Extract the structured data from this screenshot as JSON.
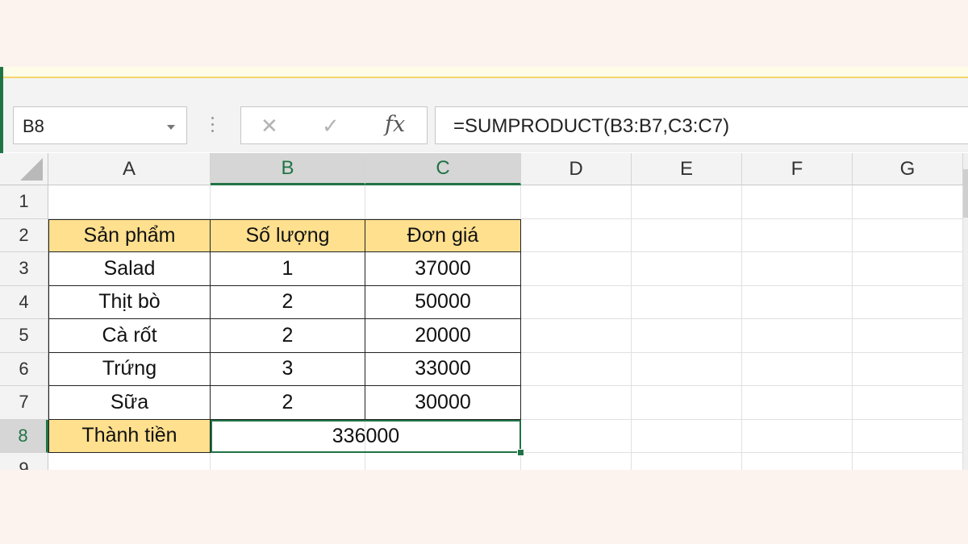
{
  "formula_bar": {
    "name_box": "B8",
    "cancel_icon": "✕",
    "enter_icon": "✓",
    "fx_label": "fx",
    "formula": "=SUMPRODUCT(B3:B7,C3:C7)"
  },
  "columns": [
    "A",
    "B",
    "C",
    "D",
    "E",
    "F",
    "G"
  ],
  "rows": [
    "1",
    "2",
    "3",
    "4",
    "5",
    "6",
    "7",
    "8",
    "9"
  ],
  "selected_cell": "B8",
  "colors": {
    "header_fill": "#ffe08f",
    "selection": "#217346"
  },
  "table": {
    "headers": [
      "Sản phẩm",
      "Số lượng",
      "Đơn giá"
    ],
    "rows": [
      [
        "Salad",
        "1",
        "37000"
      ],
      [
        "Thịt bò",
        "2",
        "50000"
      ],
      [
        "Cà rốt",
        "2",
        "20000"
      ],
      [
        "Trứng",
        "3",
        "33000"
      ],
      [
        "Sữa",
        "2",
        "30000"
      ]
    ],
    "total_label": "Thành tiền",
    "total_value": "336000"
  }
}
